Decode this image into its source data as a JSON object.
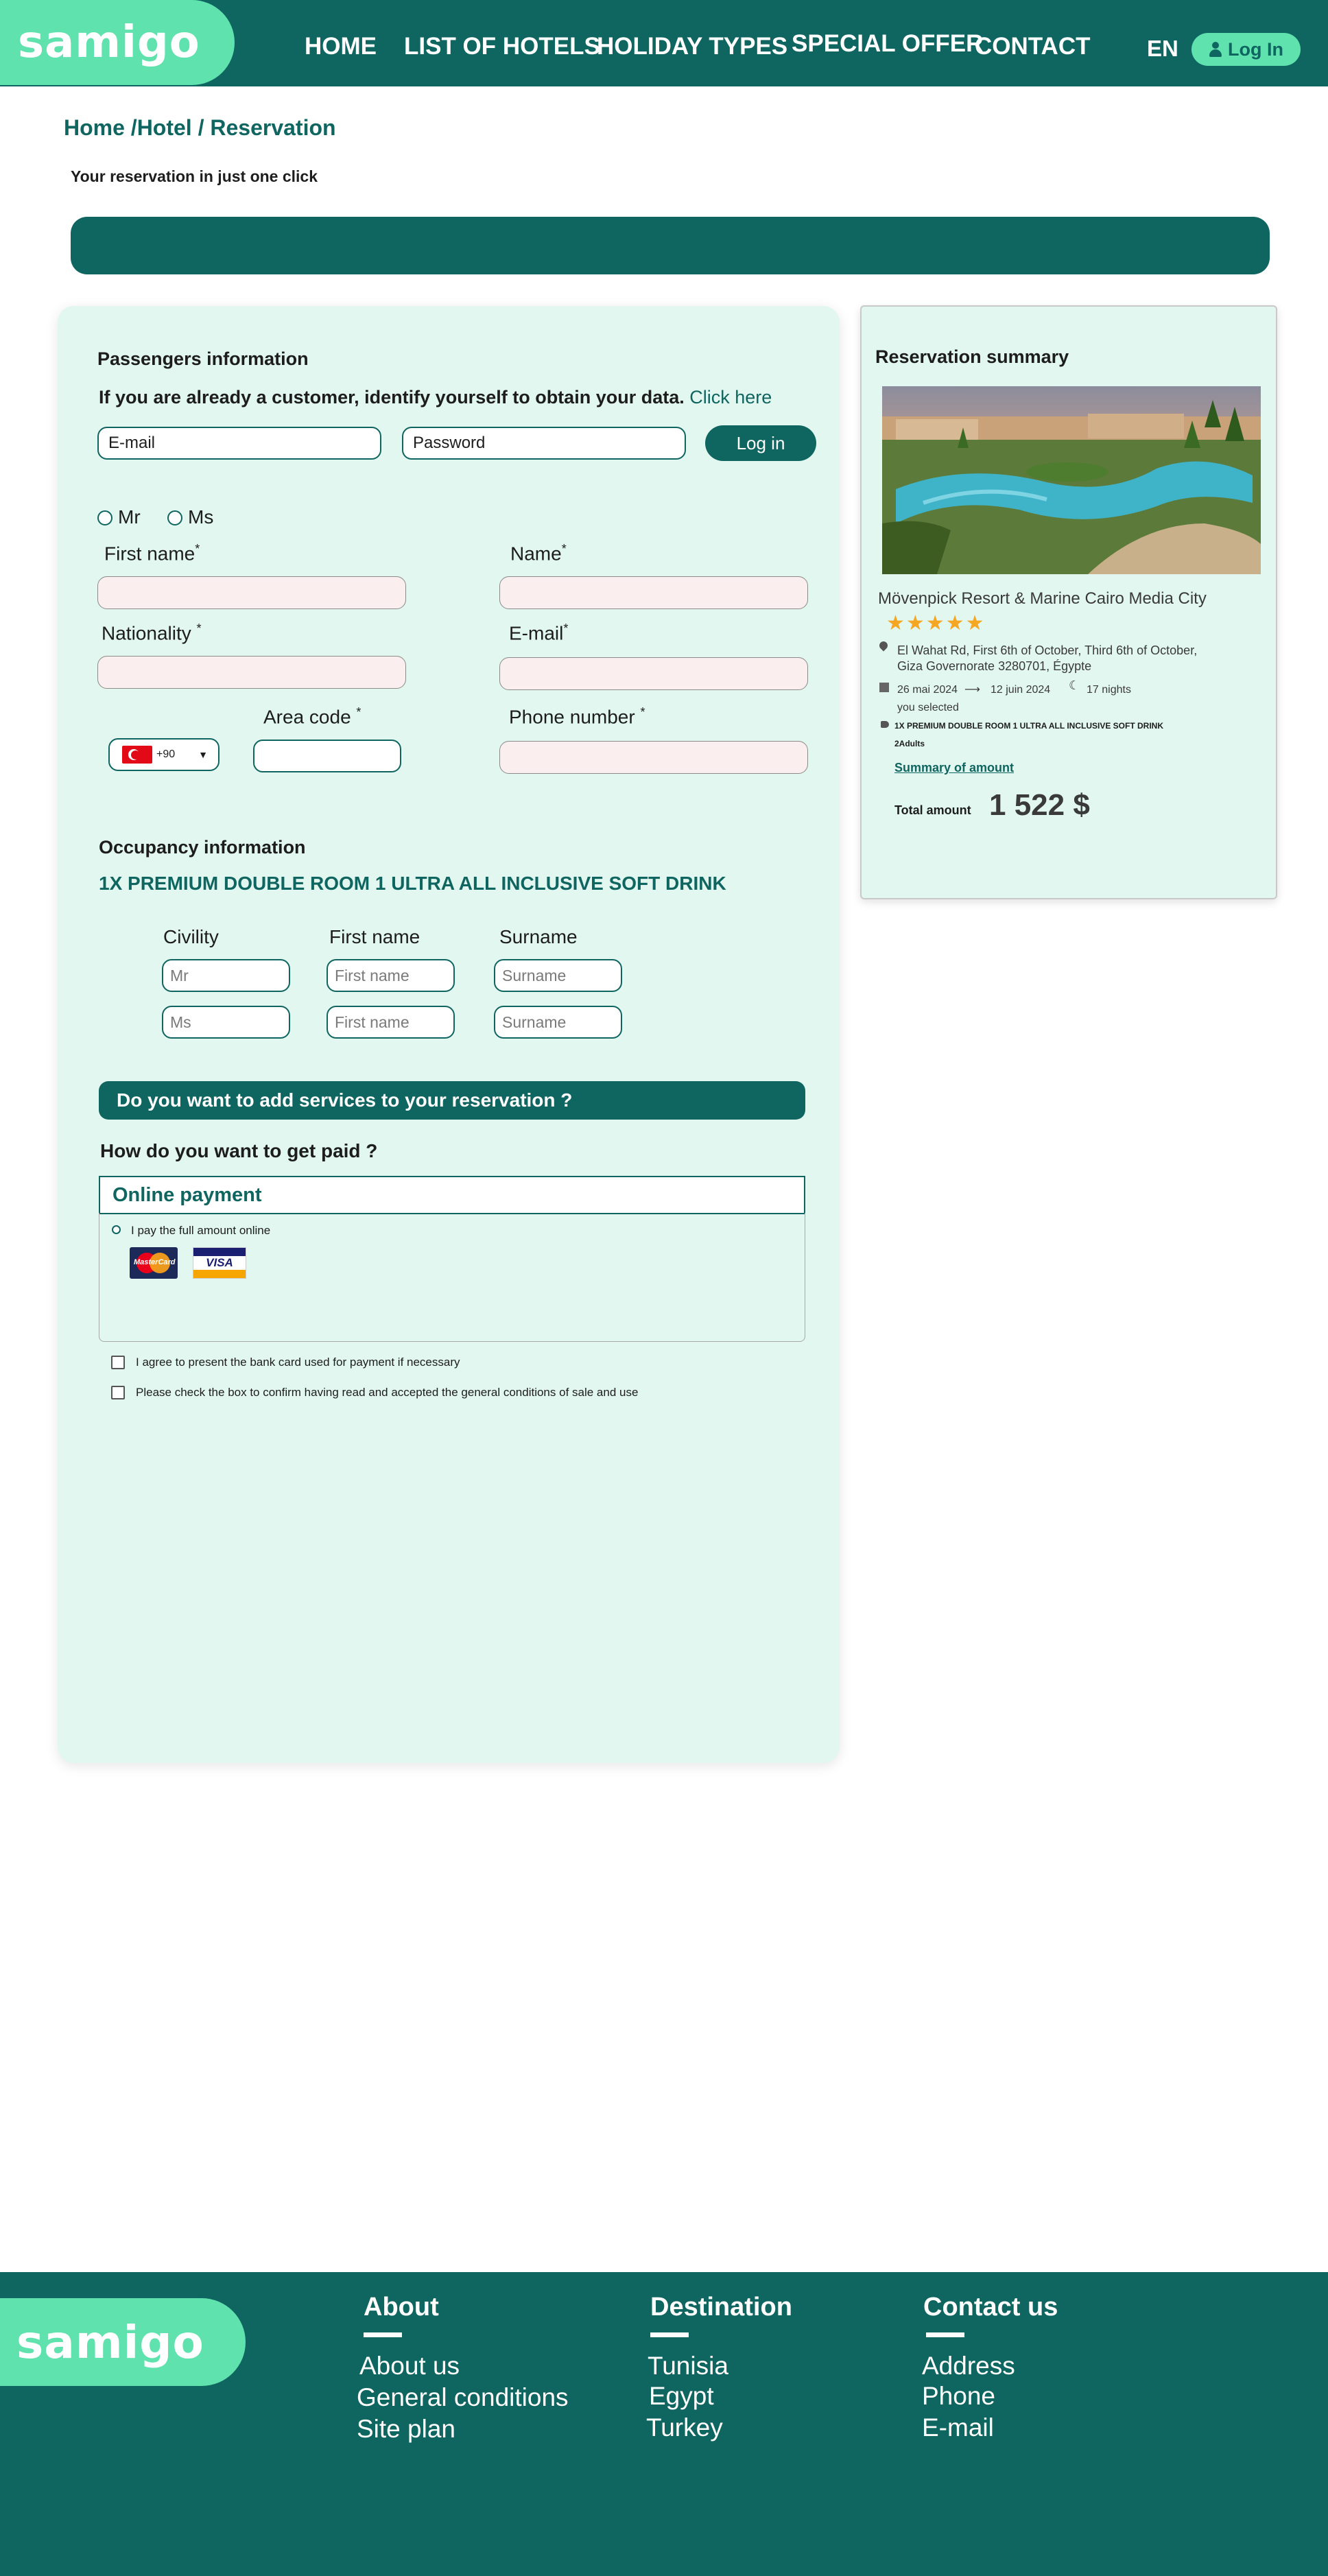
{
  "header": {
    "logo": "samigo",
    "nav": [
      "HOME",
      "LIST OF HOTELS",
      "HOLIDAY TYPES",
      "SPECIAL OFFER",
      "CONTACT"
    ],
    "lang": "EN",
    "login_label": "Log In"
  },
  "breadcrumb": "Home /Hotel / Reservation",
  "subtitle": "Your reservation in just one click",
  "passengers": {
    "title": "Passengers  information",
    "identify_text": "If you are already a customer, identify yourself to obtain your data.",
    "identify_link": "Click here",
    "email_placeholder": "E-mail",
    "password_placeholder": "Password",
    "login_button": "Log in",
    "mr": "Mr",
    "ms": "Ms",
    "first_name": "First name",
    "name": "Name",
    "nationality": "Nationality",
    "email": "E-mail",
    "area_code": "Area code",
    "phone_number": "Phone number",
    "required_mark": "*",
    "dial_code": "+90"
  },
  "occupancy": {
    "title": "Occupancy information",
    "room": "1X PREMIUM DOUBLE ROOM 1 ULTRA ALL INCLUSIVE SOFT DRINK",
    "headers": [
      "Civility",
      "First name",
      "Surname"
    ],
    "rows": [
      [
        "Mr",
        "First name",
        "Surname"
      ],
      [
        "Ms",
        "First name",
        "Surname"
      ]
    ]
  },
  "services_bar": "Do you want to add services to your reservation ?",
  "payment": {
    "question": "How do you want to get paid ?",
    "online_title": "Online payment",
    "full_online": "I pay the full amount online",
    "mastercard": "MasterCard",
    "visa": "VISA",
    "agree_card": "I agree to present the bank card used for payment if necessary",
    "agree_terms": "Please check the box to confirm having read and accepted the general conditions of sale and use"
  },
  "summary": {
    "title": "Reservation summary",
    "hotel": "Mövenpick Resort & Marine Cairo Media City",
    "stars": "★★★★★",
    "address_line1": "El Wahat Rd, First 6th of October, Third 6th of October,",
    "address_line2": "Giza Governorate 3280701, Égypte",
    "date_from": "26 mai 2024",
    "arrow": "⟶",
    "date_to": "12 juin 2024",
    "nights": "17 nights",
    "you_selected": "you selected",
    "room": "1X PREMIUM DOUBLE ROOM 1 ULTRA ALL INCLUSIVE SOFT DRINK",
    "adults": "2Adults",
    "summary_link": "Summary of amount",
    "total_label": "Total amount",
    "total_value": "1 522 $"
  },
  "footer": {
    "logo": "samigo",
    "about": {
      "title": "About",
      "items": [
        "About us",
        "General conditions",
        "Site plan"
      ]
    },
    "destination": {
      "title": "Destination",
      "items": [
        "Tunisia",
        "Egypt",
        "Turkey"
      ]
    },
    "contact": {
      "title": "Contact us",
      "items": [
        "Address",
        "Phone",
        "E-mail"
      ]
    }
  },
  "colors": {
    "primary": "#0f6560",
    "accent": "#5fe2ad",
    "panel": "#e1f7ef",
    "star": "#f5a623"
  }
}
